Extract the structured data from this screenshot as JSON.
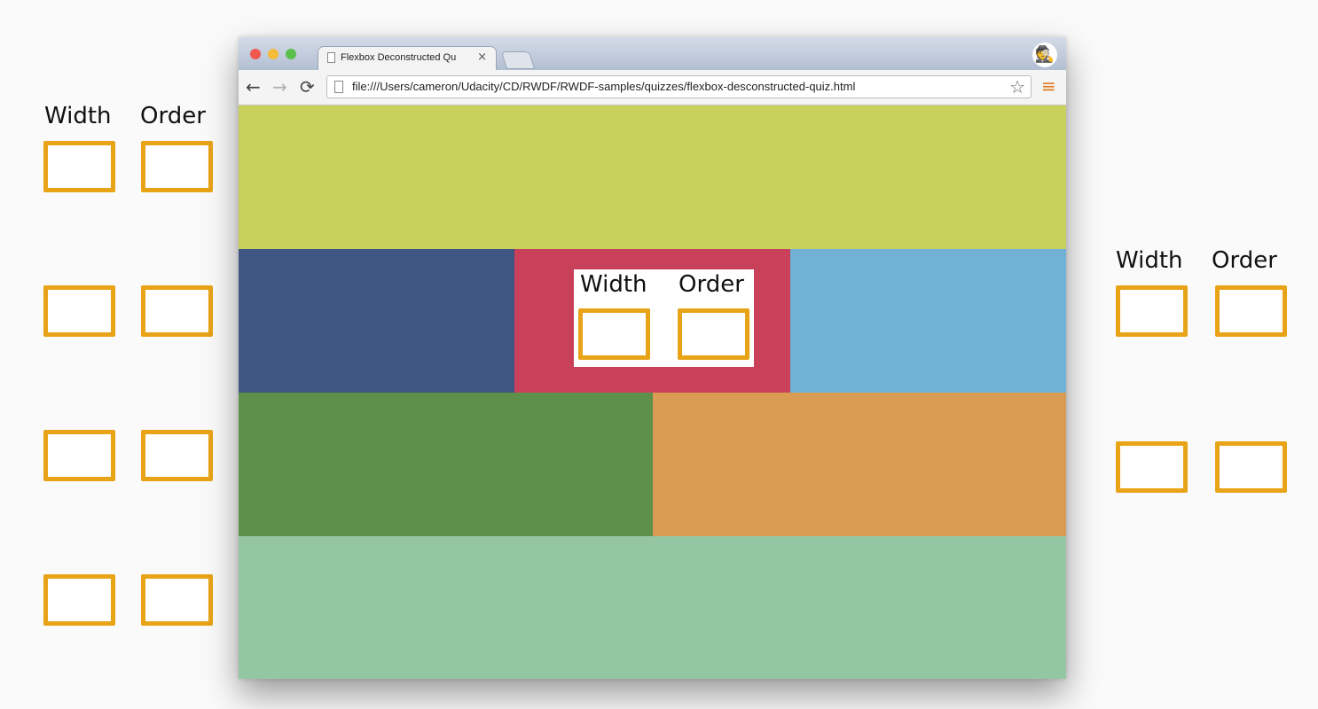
{
  "labels": {
    "width": "Width",
    "order": "Order"
  },
  "browser": {
    "tab_title": "Flexbox Deconstructed Qu",
    "tab_close": "×",
    "url": "file:///Users/cameron/Udacity/CD/RWDF/RWDF-samples/quizzes/flexbox-desconstructed-quiz.html",
    "nav_back": "←",
    "nav_forward": "→",
    "nav_reload": "⟳",
    "star": "☆",
    "menu": "≡",
    "incognito": "🕵"
  },
  "colors": {
    "accent_border": "#e8a317",
    "block_top": "#c8d15c",
    "block_navy": "#3e5681",
    "block_red": "#c8405a",
    "block_sky": "#71b1d6",
    "block_green": "#5e8f4b",
    "block_orange": "#d99c52",
    "block_mint": "#95c6a4"
  },
  "icons": [
    "page-icon",
    "close-icon",
    "back-arrow-icon",
    "forward-arrow-icon",
    "reload-icon",
    "star-icon",
    "menu-icon",
    "incognito-icon"
  ]
}
